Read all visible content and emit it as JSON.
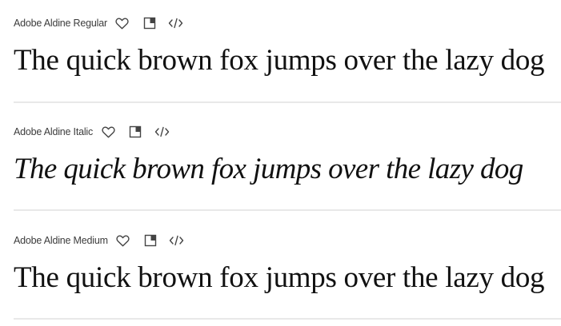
{
  "fonts": [
    {
      "name": "Adobe Aldine Regular",
      "sample": "The quick brown fox jumps over the lazy dog",
      "style": "regular",
      "icons": [
        "heart-icon",
        "publish-icon",
        "embed-code-icon"
      ]
    },
    {
      "name": "Adobe Aldine Italic",
      "sample": "The quick brown fox jumps over the lazy dog",
      "style": "italic",
      "icons": [
        "heart-icon",
        "publish-icon",
        "embed-code-icon"
      ]
    },
    {
      "name": "Adobe Aldine Medium",
      "sample": "The quick brown fox jumps over the lazy dog",
      "style": "medium",
      "icons": [
        "heart-icon",
        "publish-icon",
        "embed-code-icon"
      ]
    }
  ],
  "colors": {
    "text": "#111111",
    "meta_text": "#3c3c3c",
    "divider": "#e8e8e8",
    "icon": "#444444"
  }
}
